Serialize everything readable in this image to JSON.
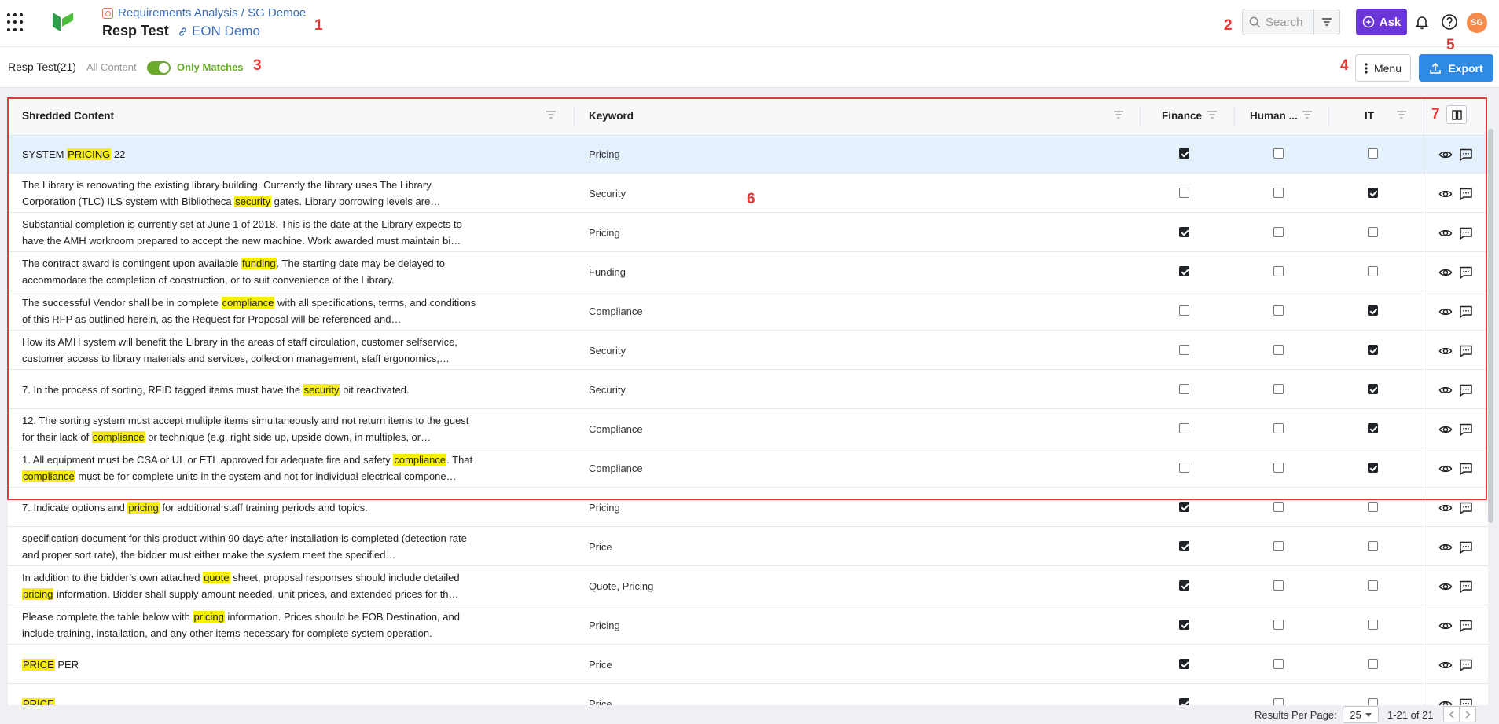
{
  "header": {
    "breadcrumb": "Requirements Analysis / SG Demoe",
    "title": "Resp Test",
    "project_link": "EON Demo",
    "search_placeholder": "Search",
    "ask_label": "Ask",
    "avatar_initials": "SG"
  },
  "toolbar": {
    "title": "Resp Test(21)",
    "all_content_label": "All Content",
    "only_matches_label": "Only Matches",
    "menu_label": "Menu",
    "export_label": "Export"
  },
  "annotations": [
    "1",
    "2",
    "3",
    "4",
    "5",
    "6",
    "7"
  ],
  "table": {
    "columns": {
      "content": "Shredded Content",
      "keyword": "Keyword",
      "finance": "Finance",
      "human": "Human ...",
      "it": "IT"
    },
    "rows": [
      {
        "segments": [
          [
            "SYSTEM ",
            false
          ],
          [
            "PRICING",
            true
          ],
          [
            " 22",
            false
          ]
        ],
        "keyword": "Pricing",
        "finance": true,
        "human": false,
        "it": false,
        "selected": true
      },
      {
        "segments": [
          [
            "The Library is renovating the existing library building. Currently the library uses The Library Corporation (TLC) ILS system with Bibliotheca ",
            false
          ],
          [
            "security",
            true
          ],
          [
            " gates. Library borrowing levels are…",
            false
          ]
        ],
        "keyword": "Security",
        "finance": false,
        "human": false,
        "it": true
      },
      {
        "segments": [
          [
            "Substantial completion is currently set at June 1 of 2018. This is the date at the Library expects to have the AMH workroom prepared to accept the new machine. Work awarded must maintain bi…",
            false
          ]
        ],
        "keyword": "Pricing",
        "finance": true,
        "human": false,
        "it": false
      },
      {
        "segments": [
          [
            "The contract award is contingent upon available ",
            false
          ],
          [
            "funding",
            true
          ],
          [
            ". The starting date may be delayed to accommodate the completion of construction, or to suit convenience of the Library.",
            false
          ]
        ],
        "keyword": "Funding",
        "finance": true,
        "human": false,
        "it": false
      },
      {
        "segments": [
          [
            "The successful Vendor shall be in complete ",
            false
          ],
          [
            "compliance",
            true
          ],
          [
            " with all specifications, terms, and conditions of this RFP as outlined herein, as the Request for Proposal will be referenced and…",
            false
          ]
        ],
        "keyword": "Compliance",
        "finance": false,
        "human": false,
        "it": true
      },
      {
        "segments": [
          [
            "How its AMH system will benefit the Library in the areas of staff circulation, customer selfservice, customer access to library materials and services, collection management, staff ergonomics,…",
            false
          ]
        ],
        "keyword": "Security",
        "finance": false,
        "human": false,
        "it": true
      },
      {
        "segments": [
          [
            "7. In the process of sorting, RFID tagged items must have the ",
            false
          ],
          [
            "security",
            true
          ],
          [
            " bit reactivated.",
            false
          ]
        ],
        "keyword": "Security",
        "finance": false,
        "human": false,
        "it": true
      },
      {
        "segments": [
          [
            "12. The sorting system must accept multiple items simultaneously and not return items to the guest for their lack of ",
            false
          ],
          [
            "compliance",
            true
          ],
          [
            " or technique (e.g. right side up, upside down, in multiples, or…",
            false
          ]
        ],
        "keyword": "Compliance",
        "finance": false,
        "human": false,
        "it": true
      },
      {
        "segments": [
          [
            "1. All equipment must be CSA or UL or ETL approved for adequate fire and safety ",
            false
          ],
          [
            "compliance",
            true
          ],
          [
            ". That ",
            false
          ],
          [
            "compliance",
            true
          ],
          [
            " must be for complete units in the system and not for individual electrical compone…",
            false
          ]
        ],
        "keyword": "Compliance",
        "finance": false,
        "human": false,
        "it": true
      },
      {
        "segments": [
          [
            "7. Indicate options and ",
            false
          ],
          [
            "pricing",
            true
          ],
          [
            " for additional staff training periods and topics.",
            false
          ]
        ],
        "keyword": "Pricing",
        "finance": true,
        "human": false,
        "it": false
      },
      {
        "segments": [
          [
            "specification document for this product within 90 days after installation is completed (detection rate and proper sort rate), the bidder must either make the system meet the specified…",
            false
          ]
        ],
        "keyword": "Price",
        "finance": true,
        "human": false,
        "it": false
      },
      {
        "segments": [
          [
            "In addition to the bidder’s own attached ",
            false
          ],
          [
            "quote",
            true
          ],
          [
            " sheet, proposal responses should include detailed ",
            false
          ],
          [
            "pricing",
            true
          ],
          [
            " information. Bidder shall supply amount needed, unit prices, and extended prices for th…",
            false
          ]
        ],
        "keyword": "Quote,  Pricing",
        "finance": true,
        "human": false,
        "it": false
      },
      {
        "segments": [
          [
            "Please complete the table below with ",
            false
          ],
          [
            "pricing",
            true
          ],
          [
            " information. Prices should be FOB Destination, and include training, installation, and any other items necessary for complete system operation.",
            false
          ]
        ],
        "keyword": "Pricing",
        "finance": true,
        "human": false,
        "it": false
      },
      {
        "segments": [
          [
            "PRICE",
            true
          ],
          [
            " PER",
            false
          ]
        ],
        "keyword": "Price",
        "finance": true,
        "human": false,
        "it": false
      },
      {
        "segments": [
          [
            "PRICE",
            true
          ]
        ],
        "keyword": "Price",
        "finance": true,
        "human": false,
        "it": false
      }
    ]
  },
  "footer": {
    "results_per_page_label": "Results Per Page:",
    "per_page_value": "25",
    "range_label": "1-21 of 21"
  },
  "colors": {
    "accent_green": "#6aaa2a",
    "ask_purple": "#6a35d9",
    "export_blue": "#2f8ae4",
    "annotation_red": "#e53935",
    "highlight_yellow": "#f6f000"
  }
}
